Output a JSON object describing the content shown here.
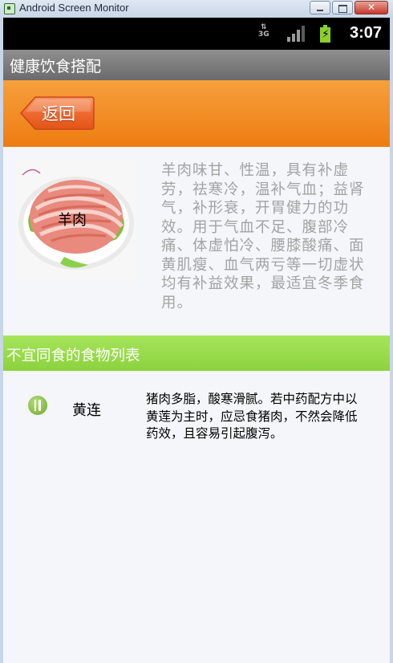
{
  "window": {
    "title": "Android Screen Monitor"
  },
  "status_bar": {
    "network": "3G",
    "time": "3:07"
  },
  "app": {
    "title": "健康饮食搭配"
  },
  "header": {
    "back_label": "返回"
  },
  "food": {
    "name": "羊肉",
    "description": "羊肉味甘、性温，具有补虚劳，祛寒冷，温补气血；益肾气，补形衰，开胃健力的功效。用于气血不足、腹部冷痛、体虚怕冷、腰膝酸痛、面黄肌瘦、血气两亏等一切虚状均有补益效果，最适宜冬季食用。"
  },
  "list": {
    "title": "不宜同食的食物列表",
    "items": [
      {
        "name": "黄连",
        "description": "猪肉多脂，酸寒滑腻。若中药配方中以黄莲为主时，应忌食猪肉，不然会降低药效，且容易引起腹泻。"
      }
    ]
  },
  "colors": {
    "header_orange": "#f08a20",
    "list_bar_green": "#98dc4a",
    "title_bar_gray": "#7c7c7c",
    "description_gray": "#a3a3a3"
  }
}
